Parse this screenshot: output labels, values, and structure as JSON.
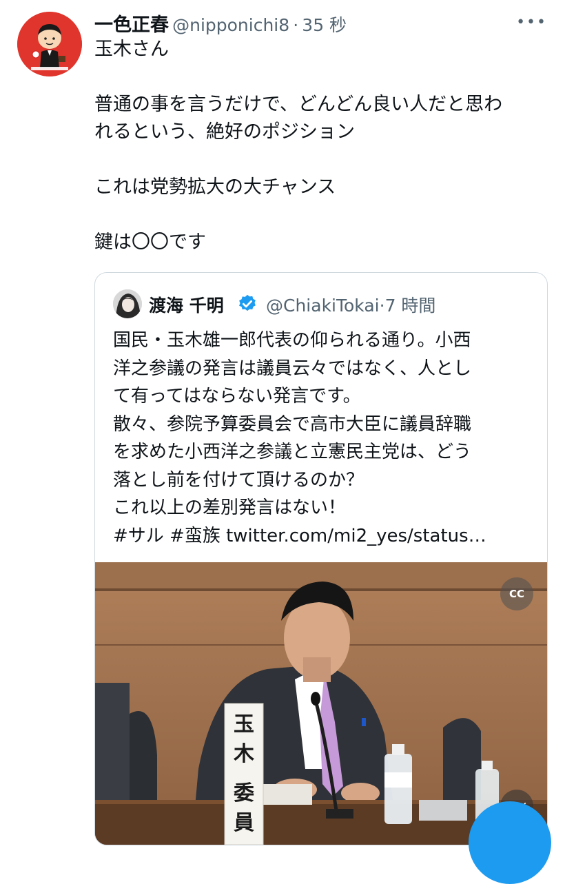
{
  "tweet": {
    "author_name": "一色正春",
    "author_handle": "@nipponichi8",
    "separator": "·",
    "time": "35 秒",
    "more_label": "•••",
    "text_lines": [
      "玉木さん",
      "",
      "普通の事を言うだけで、どんどん良い人だと思わ",
      "れるという、絶好のポジション",
      "",
      "これは党勢拡大の大チャンス",
      "",
      "鍵は〇〇です"
    ]
  },
  "quoted": {
    "author_name": "渡海 千明",
    "author_handle": "@ChiakiTokai",
    "separator": "·",
    "time": "7 時間",
    "text_lines": [
      "国民・玉木雄一郎代表の仰られる通り。小西",
      "洋之参議の発言は議員云々ではなく、人とし",
      "て有ってはならない発言です。",
      "散々、参院予算委員会で高市大臣に議員辞職",
      "を求めた小西洋之参議と立憲民主党は、どう",
      "落とし前を付けて頂けるのか？",
      "これ以上の差別発言はない！",
      "#サル #蛮族 twitter.com/mi2_yes/status…"
    ],
    "media": {
      "nameplate_text": "玉木\n委員",
      "cc_label": "CC",
      "mute_label": "◁×"
    }
  },
  "colors": {
    "avatar_bg": "#e0352c",
    "verified": "#1d9bf0",
    "accent": "#1d9bf0",
    "secondary_text": "#536471",
    "border": "#cfd9de"
  }
}
